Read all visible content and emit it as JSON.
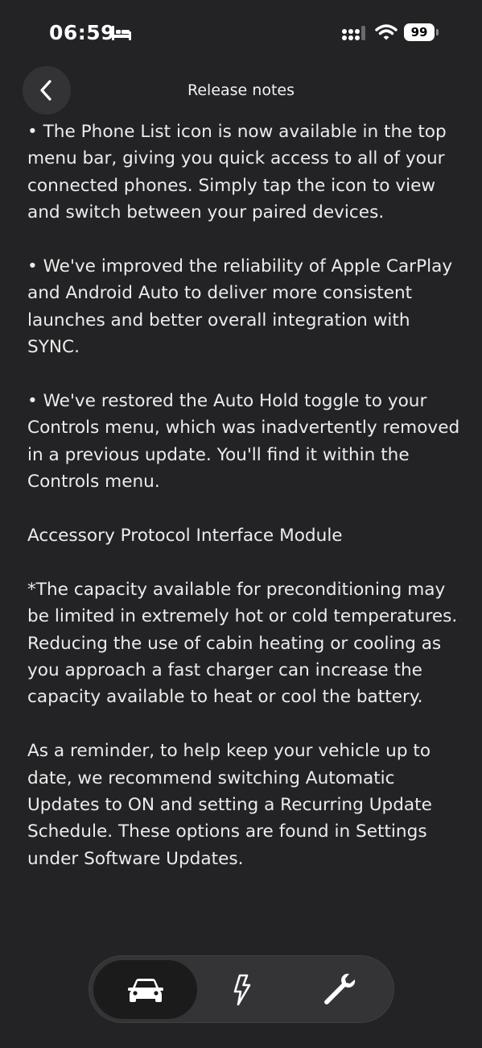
{
  "status_bar": {
    "time": "06:59",
    "battery_level": "99",
    "icons": [
      "bed-icon",
      "cellular-signal-icon",
      "wifi-icon",
      "battery-icon"
    ]
  },
  "header": {
    "title": "Release notes",
    "back_icon": "chevron-left-icon"
  },
  "content": {
    "paragraphs": [
      "• The Phone List icon is now available in the top menu bar, giving you quick access to all of your connected phones. Simply tap the icon to view and switch between your paired devices.",
      "• We've improved the reliability of Apple CarPlay and Android Auto to deliver more consistent launches and better overall integration with SYNC.",
      "• We've restored the Auto Hold toggle to your Controls menu, which was inadvertently removed in a previous update. You'll find it within the Controls menu.",
      "Accessory Protocol Interface Module",
      "*The capacity available for preconditioning may be limited in extremely hot or cold temperatures. Reducing the use of cabin heating or cooling as you approach a fast charger can increase the capacity available to heat or cool the battery.",
      "As a reminder, to help keep your vehicle up to date, we recommend switching Automatic Updates to ON and setting a Recurring Update Schedule. These options are found in Settings under Software Updates."
    ]
  },
  "bottom_nav": {
    "items": [
      {
        "icon": "car-icon",
        "active": true
      },
      {
        "icon": "lightning-bolt-icon",
        "active": false
      },
      {
        "icon": "wrench-icon",
        "active": false
      }
    ]
  },
  "colors": {
    "background": "#232325",
    "text": "#ececec",
    "nav_background": "#343437",
    "nav_active": "#1b1b1c"
  }
}
